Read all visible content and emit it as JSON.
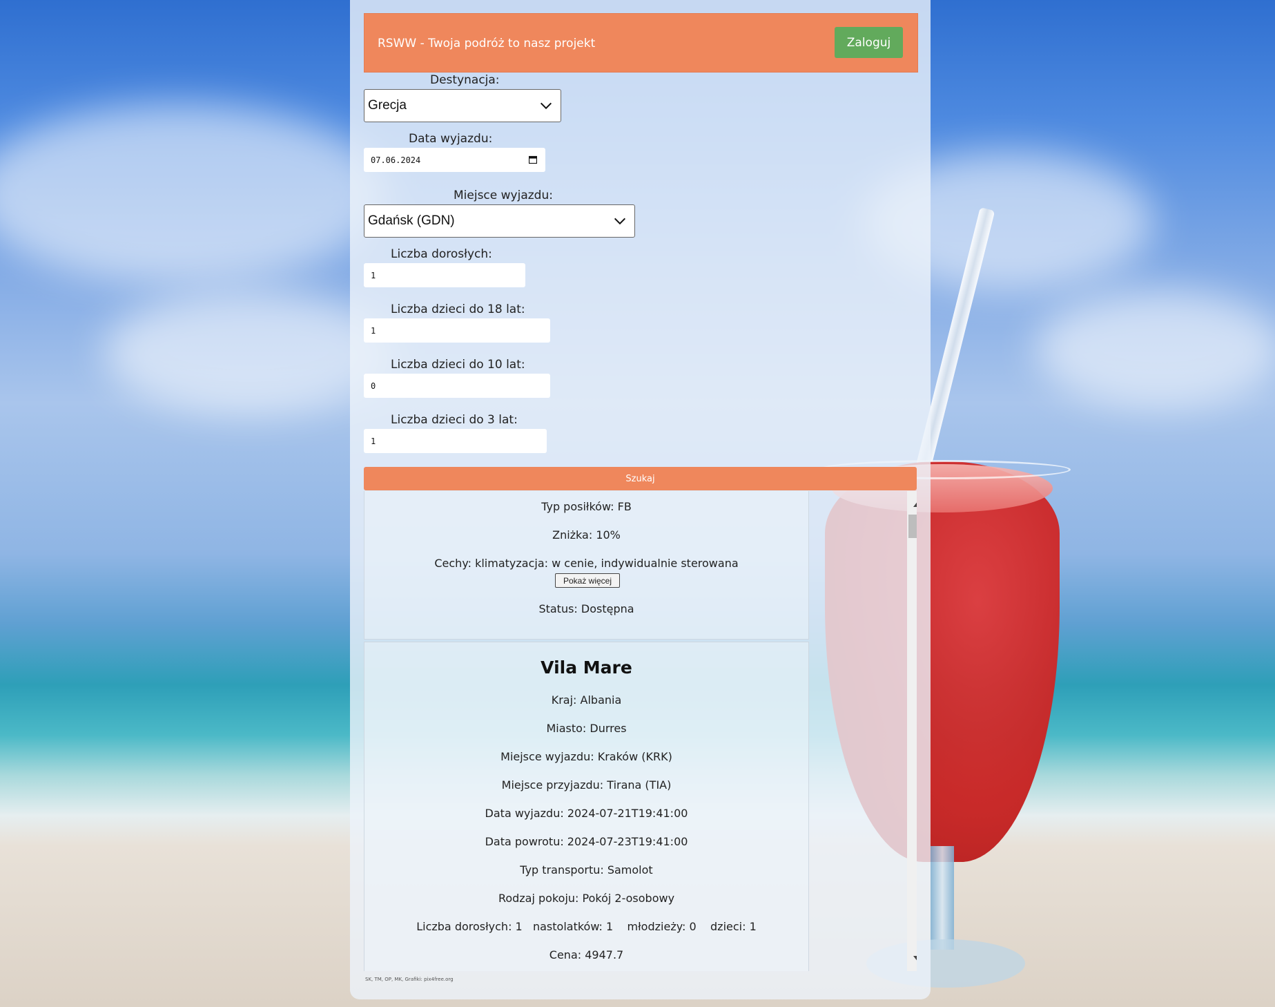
{
  "header": {
    "brand": "RSWW - Twoja podróż to nasz projekt",
    "login_label": "Zaloguj"
  },
  "form": {
    "destination": {
      "label": "Destynacja:",
      "value": "Grecja"
    },
    "departure_date": {
      "label": "Data wyjazdu:",
      "value": "07.06.2024"
    },
    "departure_place": {
      "label": "Miejsce wyjazdu:",
      "value": "Gdańsk (GDN)"
    },
    "adults": {
      "label": "Liczba dorosłych:",
      "value": "1"
    },
    "kids18": {
      "label": "Liczba dzieci do 18 lat:",
      "value": "1"
    },
    "kids10": {
      "label": "Liczba dzieci do 10 lat:",
      "value": "0"
    },
    "kids3": {
      "label": "Liczba dzieci do 3 lat:",
      "value": "1"
    },
    "search_label": "Szukaj"
  },
  "results": [
    {
      "meals": "Typ posiłków: FB",
      "discount": "Zniżka: 10%",
      "features": "Cechy: klimatyzacja: w cenie, indywidualnie sterowana",
      "more_label": "Pokaż więcej",
      "status": "Status: Dostępna"
    },
    {
      "name": "Vila Mare",
      "country": "Kraj: Albania",
      "city": "Miasto: Durres",
      "departure_place": "Miejsce wyjazdu: Kraków (KRK)",
      "arrival_place": "Miejsce przyjazdu: Tirana (TIA)",
      "departure_date": "Data wyjazdu: 2024-07-21T19:41:00",
      "return_date": "Data powrotu: 2024-07-23T19:41:00",
      "transport": "Typ transportu: Samolot",
      "room": "Rodzaj pokoju: Pokój 2-osobowy",
      "counts": "Liczba dorosłych: 1   nastolatków: 1    młodzieży: 0    dzieci: 1",
      "price": "Cena: 4947.7"
    }
  ],
  "footer": "SK, TM, OP, MK, Grafiki: pix4free.org",
  "colors": {
    "accent": "#ef875c",
    "login": "#62aa5c"
  }
}
